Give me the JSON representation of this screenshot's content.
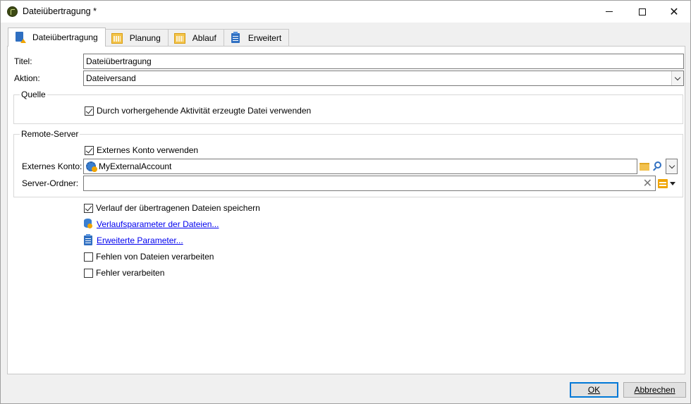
{
  "window": {
    "title": "Dateiübertragung *",
    "minimize_glyph": "",
    "maximize_glyph": "",
    "close_glyph": "✕"
  },
  "tabs": [
    {
      "label": "Dateiübertragung",
      "icon": "document-upload-icon",
      "active": true
    },
    {
      "label": "Planung",
      "icon": "calendar-icon",
      "active": false
    },
    {
      "label": "Ablauf",
      "icon": "calendar-icon",
      "active": false
    },
    {
      "label": "Erweitert",
      "icon": "clipboard-icon",
      "active": false
    }
  ],
  "form": {
    "title_label": "Titel:",
    "title_value": "Dateiübertragung",
    "action_label": "Aktion:",
    "action_value": "Dateiversand"
  },
  "source": {
    "group_title": "Quelle",
    "use_previous_file_label": "Durch vorhergehende Aktivität erzeugte Datei verwenden",
    "use_previous_file_checked": true
  },
  "remote_server": {
    "group_title": "Remote-Server",
    "use_external_account_label": "Externes Konto verwenden",
    "use_external_account_checked": true,
    "external_account_label": "Externes Konto:",
    "external_account_value": "MyExternalAccount",
    "server_folder_label": "Server-Ordner:",
    "server_folder_value": ""
  },
  "options": {
    "save_history_label": "Verlauf der übertragenen Dateien speichern",
    "save_history_checked": true,
    "history_params_link": "Verlaufsparameter der Dateien...",
    "advanced_params_link": "Erweiterte Parameter...",
    "process_missing_files_label": "Fehlen von Dateien verarbeiten",
    "process_missing_files_checked": false,
    "process_errors_label": "Fehler verarbeiten",
    "process_errors_checked": false
  },
  "footer": {
    "ok_label": "OK",
    "cancel_label": "Abbrechen"
  },
  "colors": {
    "link": "#0000ee",
    "accent_blue": "#2f6fc1",
    "accent_orange": "#f0a400",
    "default_button_border": "#0078d7"
  }
}
